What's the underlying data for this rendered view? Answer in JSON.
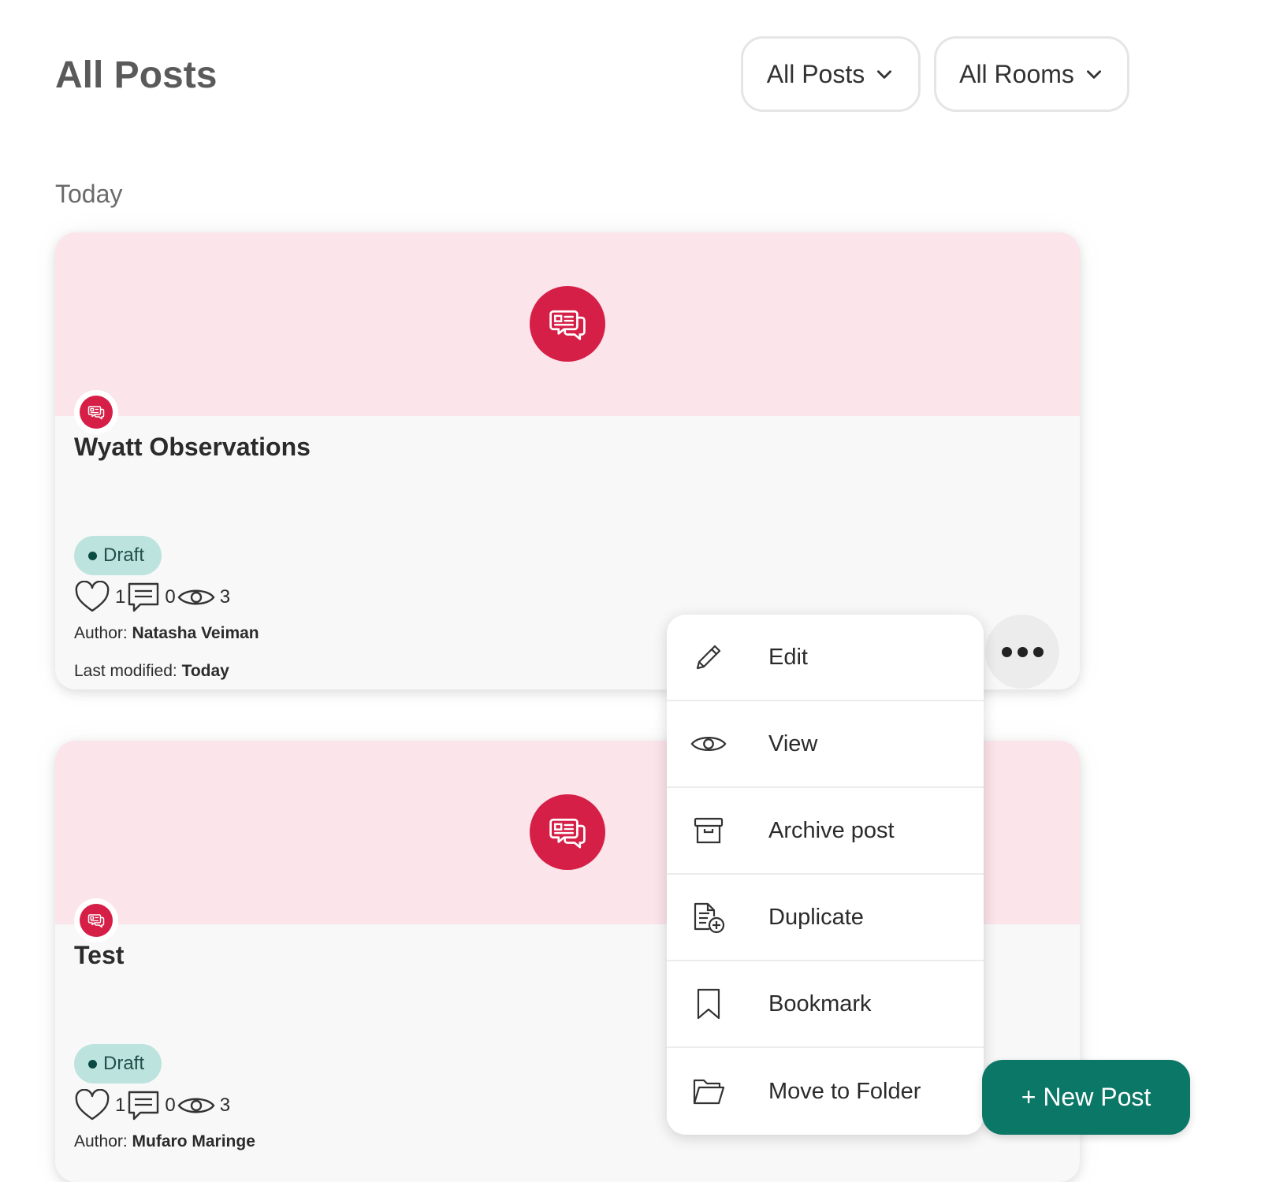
{
  "header": {
    "title": "All Posts",
    "filters": [
      {
        "label": "All Posts",
        "icon": "chevron-down-icon"
      },
      {
        "label": "All Rooms",
        "icon": "chevron-down-icon"
      }
    ]
  },
  "section": {
    "label": "Today"
  },
  "posts": [
    {
      "title": "Wyatt Observations",
      "status": "Draft",
      "likes": "1",
      "comments": "0",
      "views": "3",
      "author_label": "Author: ",
      "author": "Natasha Veiman",
      "modified_label": "Last modified: ",
      "modified": "Today"
    },
    {
      "title": "Test",
      "status": "Draft",
      "likes": "1",
      "comments": "0",
      "views": "3",
      "author_label": "Author: ",
      "author": "Mufaro Maringe"
    }
  ],
  "menu": {
    "items": [
      {
        "label": "Edit",
        "icon": "pencil-icon"
      },
      {
        "label": "View",
        "icon": "eye-icon"
      },
      {
        "label": "Archive post",
        "icon": "archive-icon"
      },
      {
        "label": "Duplicate",
        "icon": "duplicate-icon"
      },
      {
        "label": "Bookmark",
        "icon": "bookmark-icon"
      },
      {
        "label": "Move to Folder",
        "icon": "folder-icon"
      }
    ]
  },
  "new_post_button": {
    "label": "+ New Post"
  },
  "colors": {
    "accent_red": "#d61f46",
    "hero_pink": "#fbe4ea",
    "draft_badge": "#bde3de",
    "primary_green": "#0b7766"
  }
}
